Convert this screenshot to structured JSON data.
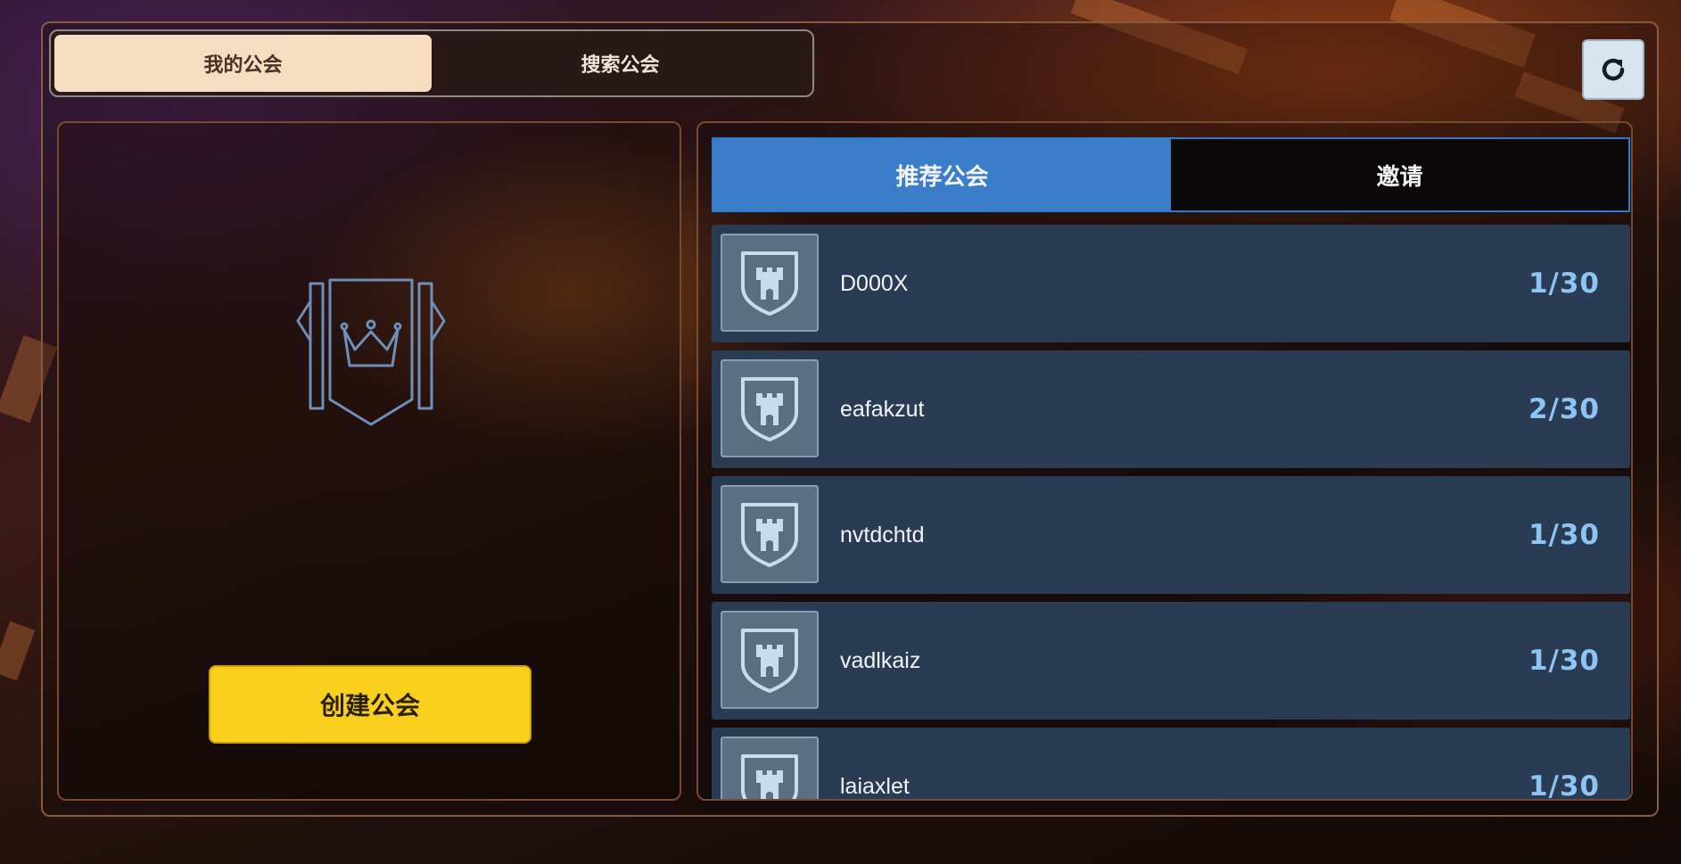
{
  "top_tabs": {
    "my_guild": "我的公会",
    "search_guild": "搜索公会"
  },
  "refresh": {
    "icon": "refresh-icon"
  },
  "left_panel": {
    "emblem_icon": "guild-crown-banner-icon",
    "create_button": "创建公会"
  },
  "right_panel": {
    "tabs": {
      "recommended": "推荐公会",
      "invite": "邀请"
    },
    "guilds": [
      {
        "name": "D000X",
        "members": "1/30",
        "icon": "castle-shield-icon"
      },
      {
        "name": "eafakzut",
        "members": "2/30",
        "icon": "castle-shield-icon"
      },
      {
        "name": "nvtdchtd",
        "members": "1/30",
        "icon": "castle-shield-icon"
      },
      {
        "name": "vadlkaiz",
        "members": "1/30",
        "icon": "castle-shield-icon"
      },
      {
        "name": "laiaxlet",
        "members": "1/30",
        "icon": "castle-shield-icon"
      }
    ]
  },
  "colors": {
    "active_top_tab": "#f6dcc0",
    "active_sub_tab": "#3a7dc8",
    "create_button": "#f9cf1e",
    "row_background": "#2a3b54",
    "member_count": "#8cc4f4"
  }
}
